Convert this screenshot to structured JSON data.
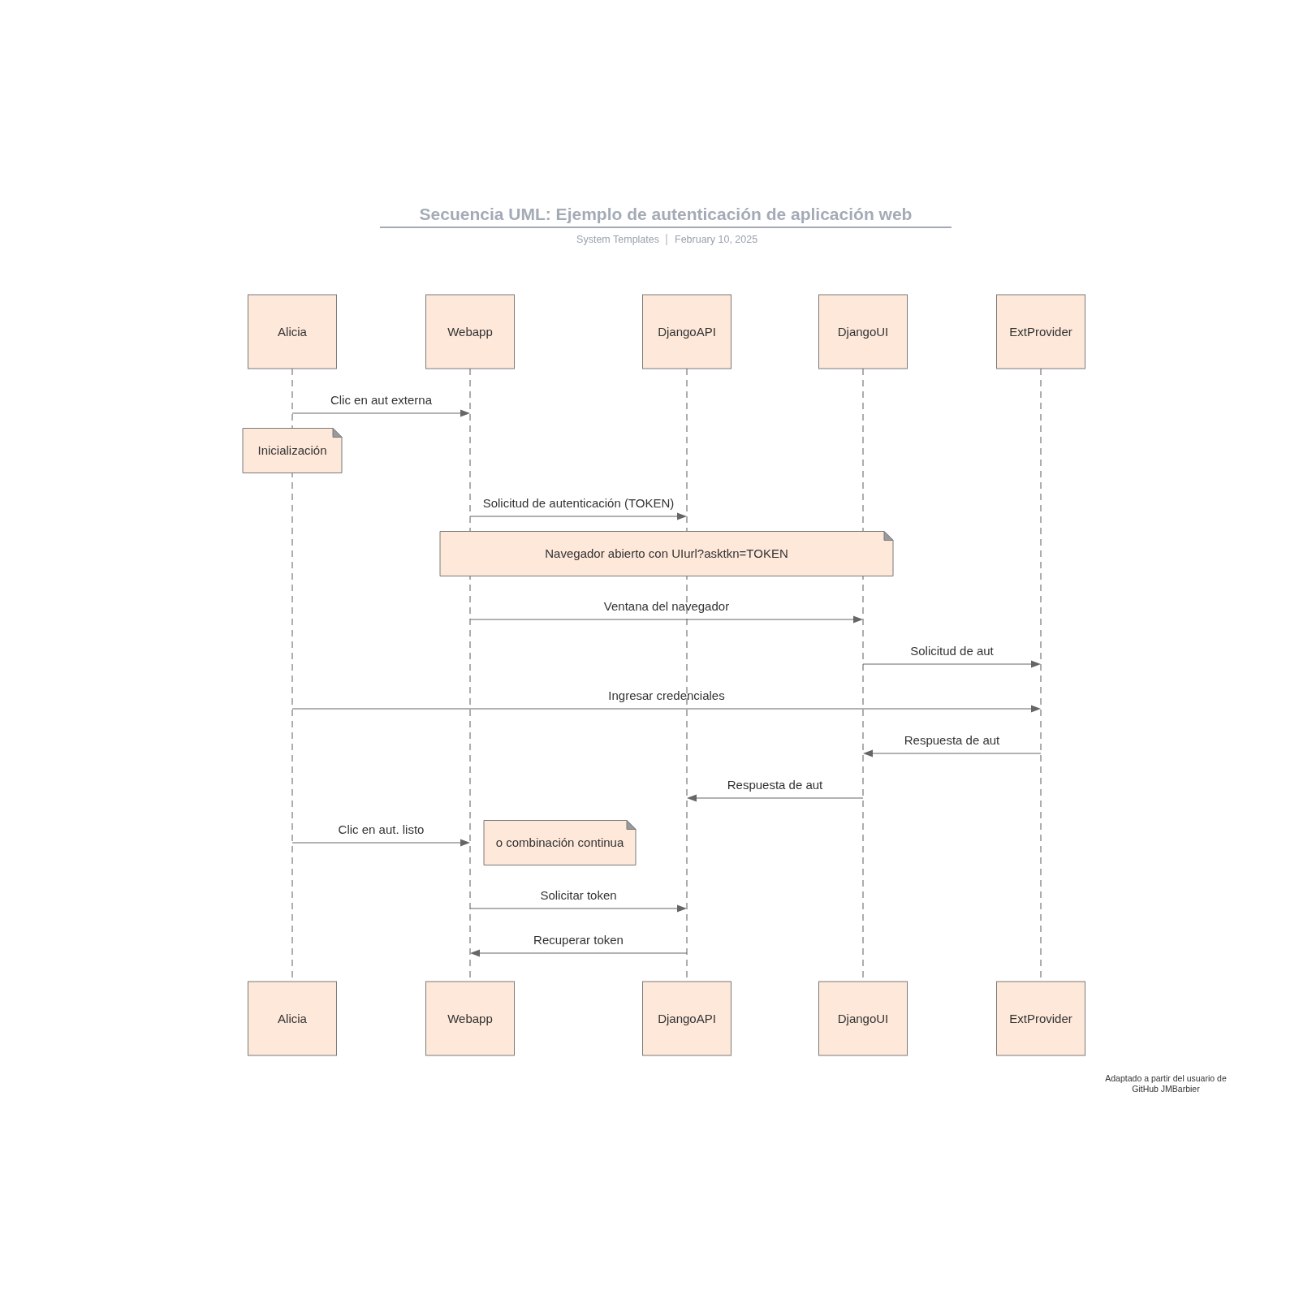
{
  "title": "Secuencia UML: Ejemplo de autenticación de aplicación web",
  "subtitle": {
    "source": "System Templates",
    "date": "February 10, 2025"
  },
  "participants_top": [
    "Alicia",
    "Webapp",
    "DjangoAPI",
    "DjangoUI",
    "ExtProvider"
  ],
  "participants_bottom": [
    "Alicia",
    "Webapp",
    "DjangoAPI",
    "DjangoUI",
    "ExtProvider"
  ],
  "steps": [
    {
      "kind": "message",
      "label": "Clic en aut externa"
    },
    {
      "kind": "note",
      "text": "Inicialización"
    },
    {
      "kind": "message",
      "label": "Solicitud de autenticación (TOKEN)"
    },
    {
      "kind": "note",
      "text": "Navegador abierto con UIurl?asktkn=TOKEN"
    },
    {
      "kind": "message",
      "label": "Ventana del navegador"
    },
    {
      "kind": "message",
      "label": "Solicitud de aut"
    },
    {
      "kind": "message",
      "label": "Ingresar credenciales"
    },
    {
      "kind": "message",
      "label": "Respuesta de aut"
    },
    {
      "kind": "message",
      "label": "Respuesta de aut"
    },
    {
      "kind": "message",
      "label": "Clic en aut. listo"
    },
    {
      "kind": "note",
      "text": "o combinación continua"
    },
    {
      "kind": "message",
      "label": "Solicitar token"
    },
    {
      "kind": "message",
      "label": "Recuperar token"
    }
  ],
  "attribution": [
    "Adaptado a partir del usuario de",
    "GitHub JMBarbier"
  ]
}
